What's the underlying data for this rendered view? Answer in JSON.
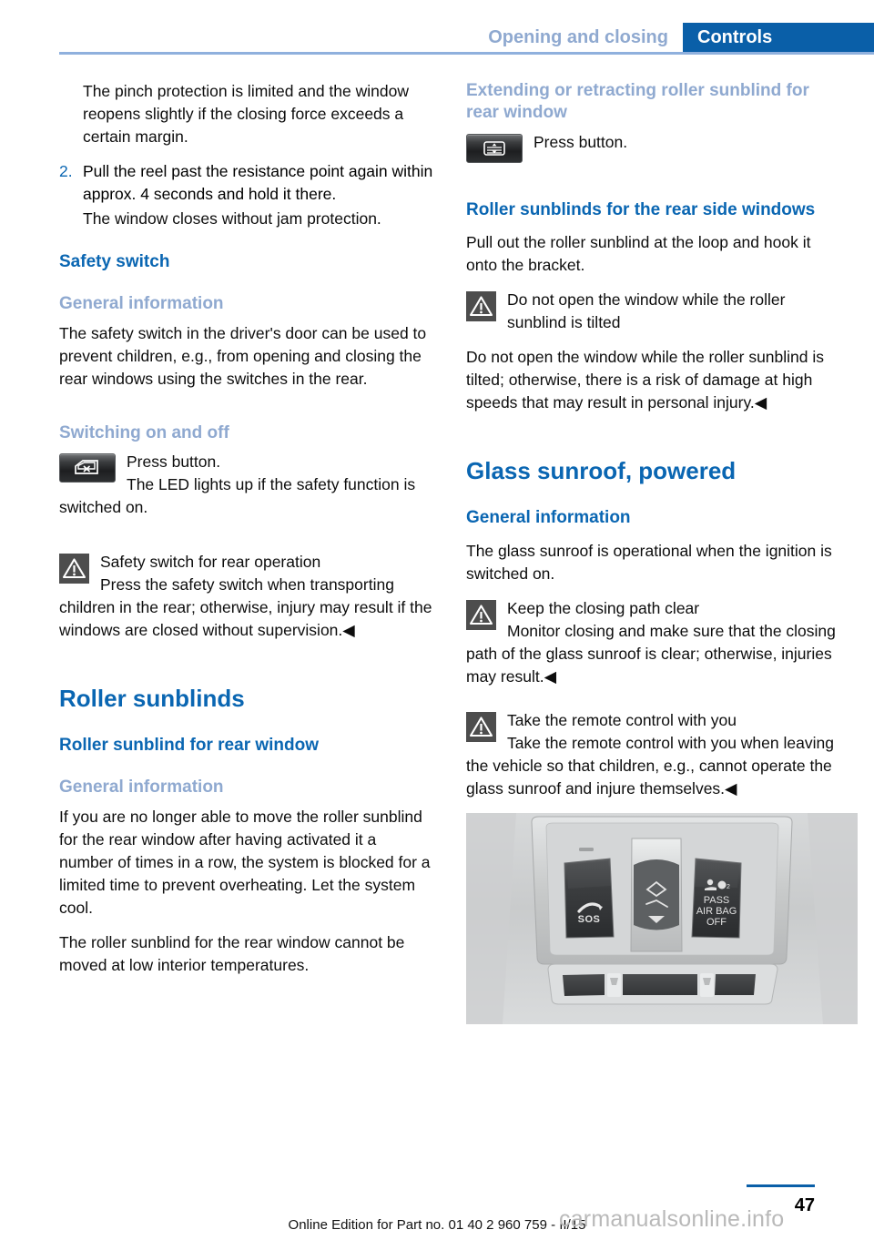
{
  "header": {
    "breadcrumb_secondary": "Opening and closing",
    "breadcrumb_primary": "Controls"
  },
  "left_column": {
    "para_pinch": "The pinch protection is limited and the window reopens slightly if the closing force exceeds a certain margin.",
    "step2_number": "2.",
    "step2_text": "Pull the reel past the resistance point again within approx. 4 seconds and hold it there.",
    "step2_result": "The window closes without jam protection.",
    "heading_safety_switch": "Safety switch",
    "heading_general_information": "General information",
    "para_safety_switch": "The safety switch in the driver's door can be used to prevent children, e.g., from opening and closing the rear windows using the switches in the rear.",
    "heading_switching_on_off": "Switching on and off",
    "press_button_label": "Press button.",
    "led_text": "The LED lights up if the safety function is switched on.",
    "warning_title": "Safety switch for rear operation",
    "warning_body": "Press the safety switch when transporting children in the rear; otherwise, injury may result if the windows are closed without supervision.◀",
    "heading_roller_sunblinds": "Roller sunblinds",
    "heading_roller_sunblind_rear_window": "Roller sunblind for rear window",
    "heading_general_information_2": "General information",
    "para_blocked": "If you are no longer able to move the roller sunblind for the rear window after having activated it a number of times in a row, the system is blocked for a limited time to prevent overheating. Let the system cool.",
    "para_low_temp": "The roller sunblind for the rear window cannot be moved at low interior temperatures."
  },
  "right_column": {
    "heading_extending_retracting": "Extending or retracting roller sunblind for rear window",
    "press_button_label": "Press button.",
    "heading_rear_side_windows": "Roller sunblinds for the rear side windows",
    "para_pull_out": "Pull out the roller sunblind at the loop and hook it onto the bracket.",
    "warning1_title": "Do not open the window while the roller sunblind is tilted",
    "warning1_body": "Do not open the window while the roller sunblind is tilted; otherwise, there is a risk of damage at high speeds that may result in personal injury.◀",
    "heading_glass_sunroof": "Glass sunroof, powered",
    "heading_general_information": "General information",
    "para_operational": "The glass sunroof is operational when the ignition is switched on.",
    "warning2_title": "Keep the closing path clear",
    "warning2_body": "Monitor closing and make sure that the closing path of the glass sunroof is clear; otherwise, injuries may result.◀",
    "warning3_title": "Take the remote control with you",
    "warning3_body": "Take the remote control with you when leaving the vehicle so that children, e.g., cannot operate the glass sunroof and injure themselves.◀",
    "photo_labels": {
      "sos": "SOS",
      "airbag_line1": "PASS",
      "airbag_line2": "AIR BAG",
      "airbag_line3": "OFF"
    }
  },
  "footer": {
    "edition": "Online Edition for Part no. 01 40 2 960 759 - II/15",
    "page_number": "47",
    "watermark": "carmanualsonline.info"
  },
  "colors": {
    "accent_blue": "#0a5fa8",
    "heading_blue": "#0a66b2",
    "subheading_blue": "#8fa9d0",
    "rule_blue": "#8fb0dd"
  }
}
